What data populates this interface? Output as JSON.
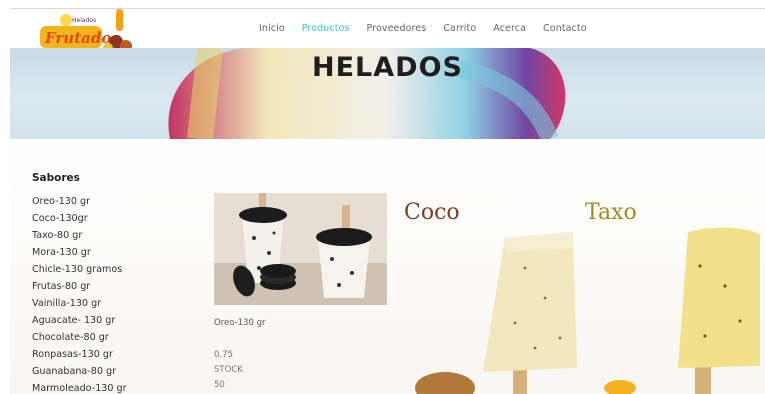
{
  "brand": {
    "logo_text": "Frutados",
    "logo_subtext": "Helados"
  },
  "nav": [
    {
      "label": "Inicio",
      "active": false
    },
    {
      "label": "Productos",
      "active": true
    },
    {
      "label": "Proveedores",
      "active": false
    },
    {
      "label": "Carrito",
      "active": false
    },
    {
      "label": "Acerca",
      "active": false
    },
    {
      "label": "Contacto",
      "active": false
    }
  ],
  "banner": {
    "title": "HELADOS"
  },
  "sidebar": {
    "title": "Sabores",
    "items": [
      "Oreo-130 gr",
      "Coco-130gr",
      "Taxo-80 gr",
      "Mora-130 gr",
      "Chicle-130 gramos",
      "Frutas-80 gr",
      "Vainilla-130 gr",
      "Aguacate- 130 gr",
      "Chocolate-80 gr",
      "Ronpasas-130 gr",
      "Guanabana-80 gr",
      "Marmoleado-130 gr"
    ]
  },
  "product": {
    "name": "Oreo-130 gr",
    "price": "0.75",
    "stock_label": "STOCK",
    "stock": "50"
  },
  "flavors": [
    {
      "name": "Coco"
    },
    {
      "name": "Taxo"
    }
  ],
  "colors": {
    "nav_active": "#3ec7b7",
    "coco_title": "#7a3e2a",
    "taxo_title": "#a38a1c"
  }
}
